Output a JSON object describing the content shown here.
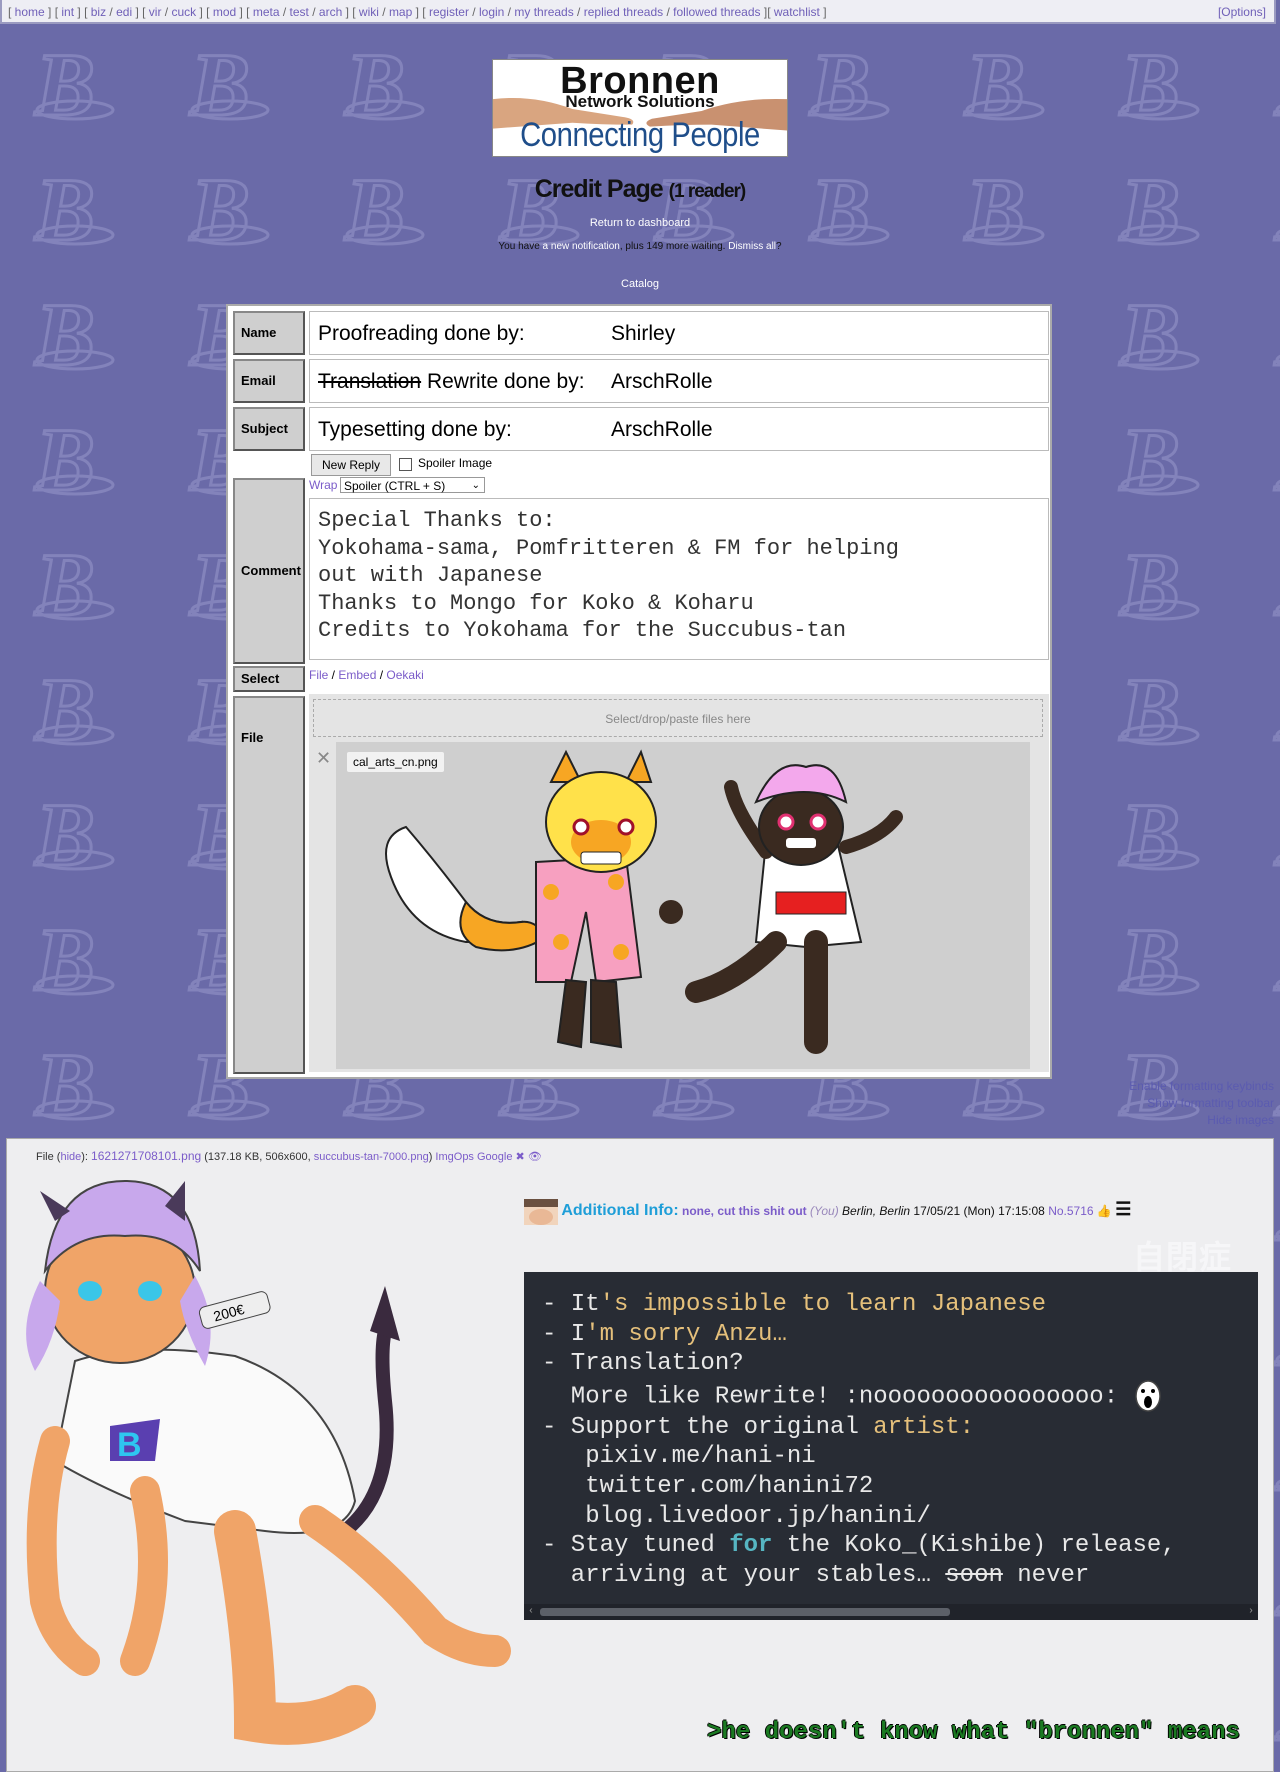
{
  "nav": {
    "groups": [
      [
        "home"
      ],
      [
        "int"
      ],
      [
        "biz",
        "edi"
      ],
      [
        "vir",
        "cuck"
      ],
      [
        "mod"
      ],
      [
        "meta",
        "test",
        "arch"
      ],
      [
        "wiki",
        "map"
      ],
      [
        "register",
        "login",
        "my threads",
        "replied threads",
        "followed threads"
      ],
      [
        "watchlist"
      ]
    ],
    "options": "[Options]"
  },
  "banner": {
    "line1": "Bronnen",
    "line2": "Network Solutions",
    "line3": "Connecting People"
  },
  "page": {
    "title": "Credit Page",
    "readers": "(1 reader)",
    "return_link": "Return to dashboard",
    "notif_prefix": "You have",
    "notif_link": "a new notification",
    "notif_mid": ", plus 149 more waiting.",
    "dismiss_link": "Dismiss all",
    "notif_suffix": "?",
    "catalog_link": "Catalog"
  },
  "form": {
    "labels": {
      "name": "Name",
      "email": "Email",
      "subject": "Subject",
      "comment": "Comment",
      "select": "Select",
      "file": "File"
    },
    "name_field": {
      "text": "Proofreading done by:",
      "value": "Shirley"
    },
    "email_field": {
      "struck": "Translation",
      "text": " Rewrite done by:",
      "value": "ArschRolle"
    },
    "subject_field": {
      "text": "Typesetting done by:",
      "value": "ArschRolle"
    },
    "new_reply_button": "New Reply",
    "spoiler_label": "Spoiler Image",
    "wrap_link": "Wrap",
    "wrap_select": "Spoiler (CTRL + S)",
    "comment": "Special Thanks to:\nYokohama-sama, Pomfritteren & FM for helping\nout with Japanese\nThanks to Mongo for Koko & Koharu\nCredits to Yokohama for the Succubus-tan",
    "select_links": [
      "File",
      "Embed",
      "Oekaki"
    ],
    "dropzone": "Select/drop/paste files here",
    "attached_file": "cal_arts_cn.png"
  },
  "formatting_links": [
    "Enable formatting keybinds",
    "Show formatting toolbar",
    "Hide images"
  ],
  "post": {
    "file_label": "File",
    "hide_link": "hide",
    "file_name": "1621271708101.png",
    "file_meta": "(137.18 KB, 506x600,",
    "orig_name": "succubus-tan-7000.png",
    "imgops": "ImgOps",
    "google": "Google",
    "subject": "Additional Info:",
    "name": "none, cut this shit out",
    "you": "(You)",
    "location": "Berlin, Berlin",
    "datetime": "17/05/21 (Mon) 17:15:08",
    "number": "No.5716",
    "watermark": "自閉症",
    "greentext": ">he doesn't know what \"bronnen\" means",
    "sticker_text": "200€"
  },
  "code_block": {
    "l1a": "- It",
    "l1b": "'s impossible to learn Japanese",
    "l2a": "- I",
    "l2b": "'m sorry Anzu…",
    "l3": "- Translation?",
    "l4": "  More like Rewrite! :noooooooooooooooo:",
    "l5a": "- Support the original ",
    "l5b": "artist:",
    "l6": "   pixiv.me/hani-ni",
    "l7": "   twitter.com/hanini72",
    "l8": "   blog.livedoor.jp/hanini/",
    "l9a": "- Stay tuned ",
    "l9b": "for",
    "l9c": " the Koko_(Kishibe) release,",
    "l10a": "  arriving at your stables… ",
    "l10b": "soon",
    "l10c": " never"
  },
  "colors": {
    "background": "#6a6aa8",
    "link": "#7b5cc9",
    "subject": "#1e9ed8",
    "code_bg": "#282c34",
    "greentext": "#1b7a22"
  }
}
